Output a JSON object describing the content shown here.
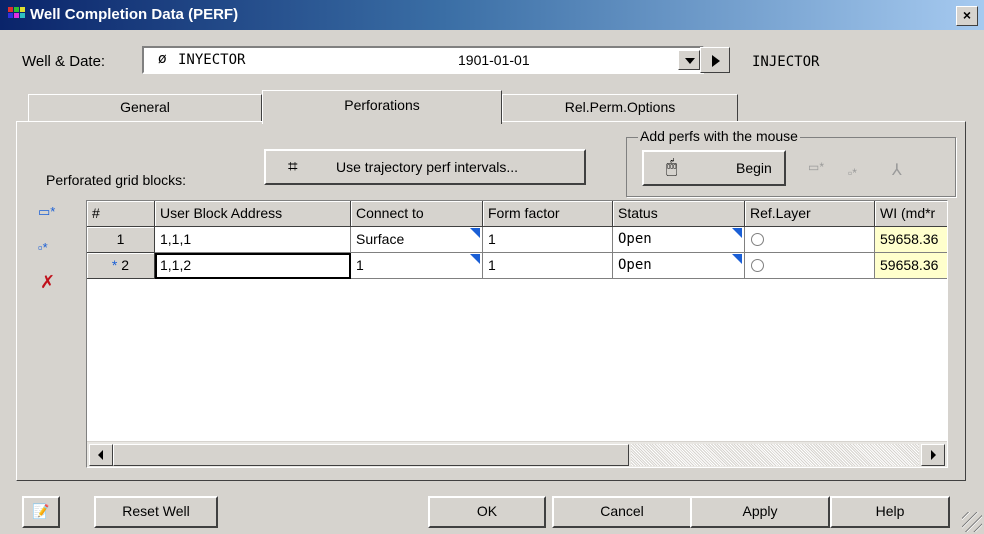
{
  "window": {
    "title": "Well Completion Data (PERF)",
    "close_label": "×"
  },
  "well_date": {
    "label": "Well & Date:",
    "symbol": "ø",
    "well_name": "INYECTOR",
    "date": "1901-01-01",
    "current_well_label": "INJECTOR"
  },
  "tabs": [
    {
      "label": "General",
      "active": false
    },
    {
      "label": "Perforations",
      "active": true
    },
    {
      "label": "Rel.Perm.Options",
      "active": false
    }
  ],
  "perforations": {
    "grid_blocks_label": "Perforated grid blocks:",
    "trajectory_button_label": "Use trajectory perf intervals...",
    "mouse_group": {
      "legend": "Add perfs with the mouse",
      "begin_label": "Begin"
    }
  },
  "table": {
    "columns": [
      "#",
      "User Block Address",
      "Connect to",
      "Form factor",
      "Status",
      "Ref.Layer",
      "WI (md*r"
    ],
    "rows": [
      {
        "num": "1",
        "address": "1,1,1",
        "connect_to": "Surface",
        "form_factor": "1",
        "status": "Open",
        "ref_layer": false,
        "wi": "59658.36"
      },
      {
        "num": "2",
        "marker": "*",
        "address": "1,1,2",
        "connect_to": "1",
        "form_factor": "1",
        "status": "Open",
        "ref_layer": false,
        "wi": "59658.36"
      }
    ]
  },
  "footer": {
    "reset_label": "Reset Well",
    "ok_label": "OK",
    "cancel_label": "Cancel",
    "apply_label": "Apply",
    "help_label": "Help"
  },
  "colors": {
    "accent": "#1a5fd6",
    "wi_cell": "#ffffcc",
    "delete_icon": "#c0101a"
  }
}
